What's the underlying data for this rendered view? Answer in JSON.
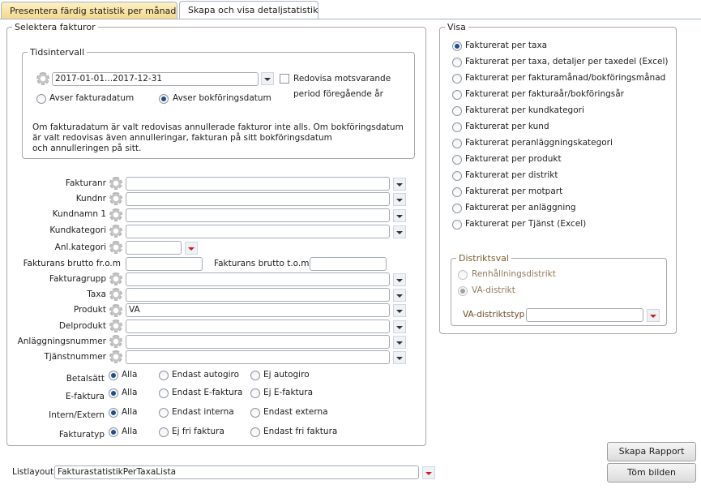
{
  "tabs": [
    {
      "label": "Presentera färdig statistik per månad"
    },
    {
      "label": "Skapa och visa detaljstatistik"
    }
  ],
  "selektera": {
    "title": "Selektera fakturor",
    "tidsintervall": {
      "title": "Tidsintervall",
      "value": "2017-01-01...2017-12-31",
      "checkbox_label_1": "Redovisa motsvarande",
      "checkbox_label_2": "period föregående år",
      "radio_fakturadatum": "Avser fakturadatum",
      "radio_bokforingsdatum": "Avser bokföringsdatum",
      "info_line1": "Om fakturadatum är valt redovisas annullerade fakturor inte alls. Om bokföringsdatum",
      "info_line2": "är valt redovisas även annulleringar, fakturan på sitt bokföringsdatum",
      "info_line3": "och annulleringen på sitt."
    },
    "fields": {
      "fakturanr": {
        "label": "Fakturanr",
        "value": ""
      },
      "kundnr": {
        "label": "Kundnr",
        "value": ""
      },
      "kundnamn": {
        "label": "Kundnamn 1",
        "value": ""
      },
      "kundkategori": {
        "label": "Kundkategori",
        "value": ""
      },
      "anlkategori": {
        "label": "Anl.kategori",
        "value": ""
      },
      "brutto_from": {
        "label": "Fakturans brutto fr.o.m",
        "value": ""
      },
      "brutto_tom": {
        "label": "Fakturans brutto t.o.m",
        "value": ""
      },
      "fakturagrupp": {
        "label": "Fakturagrupp",
        "value": ""
      },
      "taxa": {
        "label": "Taxa",
        "value": ""
      },
      "produkt": {
        "label": "Produkt",
        "value": "VA"
      },
      "delprodukt": {
        "label": "Delprodukt",
        "value": ""
      },
      "anlaggningsnummer": {
        "label": "Anläggningsnummer",
        "value": ""
      },
      "tjanstnummer": {
        "label": "Tjänstnummer",
        "value": ""
      }
    },
    "betalsatt": {
      "label": "Betalsätt",
      "options": [
        "Alla",
        "Endast autogiro",
        "Ej autogiro"
      ]
    },
    "efaktura": {
      "label": "E-faktura",
      "options": [
        "Alla",
        "Endast E-faktura",
        "Ej E-faktura"
      ]
    },
    "internextern": {
      "label": "Intern/Extern",
      "options": [
        "Alla",
        "Endast interna",
        "Endast externa"
      ]
    },
    "fakturatyp": {
      "label": "Fakturatyp",
      "options": [
        "Alla",
        "Ej fri faktura",
        "Endast fri faktura"
      ]
    }
  },
  "visa": {
    "title": "Visa",
    "options": [
      "Fakturerat per taxa",
      "Fakturerat per taxa, detaljer per taxedel (Excel)",
      "Fakturerat per fakturamånad/bokföringsmånad",
      "Fakturerat per fakturaår/bokföringsår",
      "Fakturerat per kundkategori",
      "Fakturerat per kund",
      "Fakturerat peranläggningskategori",
      "Fakturerat per produkt",
      "Fakturerat per distrikt",
      "Fakturerat per motpart",
      "Fakturerat per anläggning",
      "Fakturerat per Tjänst (Excel)"
    ],
    "selected_index": 0,
    "distriktsval": {
      "title": "Distriktsval",
      "opt1": "Renhållningsdistrikt",
      "opt2": "VA-distrikt",
      "typ_label": "VA-distriktstyp",
      "typ_value": ""
    }
  },
  "listlayout": {
    "label": "Listlayout",
    "value": "FakturastatistikPerTaxaLista"
  },
  "buttons": {
    "skapa": "Skapa Rapport",
    "tom": "Töm bilden"
  }
}
